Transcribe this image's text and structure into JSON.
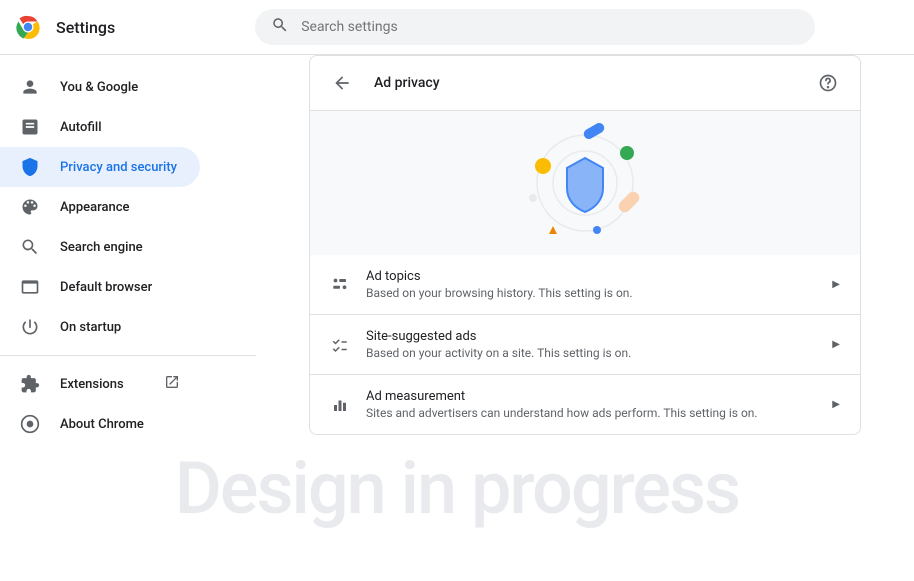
{
  "header": {
    "title": "Settings",
    "search_placeholder": "Search settings"
  },
  "sidebar": {
    "items": [
      {
        "label": "You & Google",
        "icon": "person"
      },
      {
        "label": "Autofill",
        "icon": "autofill"
      },
      {
        "label": "Privacy and security",
        "icon": "shield",
        "active": true
      },
      {
        "label": "Appearance",
        "icon": "palette"
      },
      {
        "label": "Search engine",
        "icon": "search"
      },
      {
        "label": "Default browser",
        "icon": "browser"
      },
      {
        "label": "On startup",
        "icon": "power"
      }
    ],
    "footer_items": [
      {
        "label": "Extensions",
        "icon": "extension",
        "external": true
      },
      {
        "label": "About Chrome",
        "icon": "chrome"
      }
    ]
  },
  "page": {
    "title": "Ad privacy",
    "rows": [
      {
        "title": "Ad topics",
        "desc": "Based on your browsing history. This setting is on."
      },
      {
        "title": "Site-suggested ads",
        "desc": "Based on your activity on a site. This setting is on."
      },
      {
        "title": "Ad measurement",
        "desc": "Sites and advertisers can understand how ads perform. This setting is on."
      }
    ]
  },
  "watermark": "Design in progress"
}
